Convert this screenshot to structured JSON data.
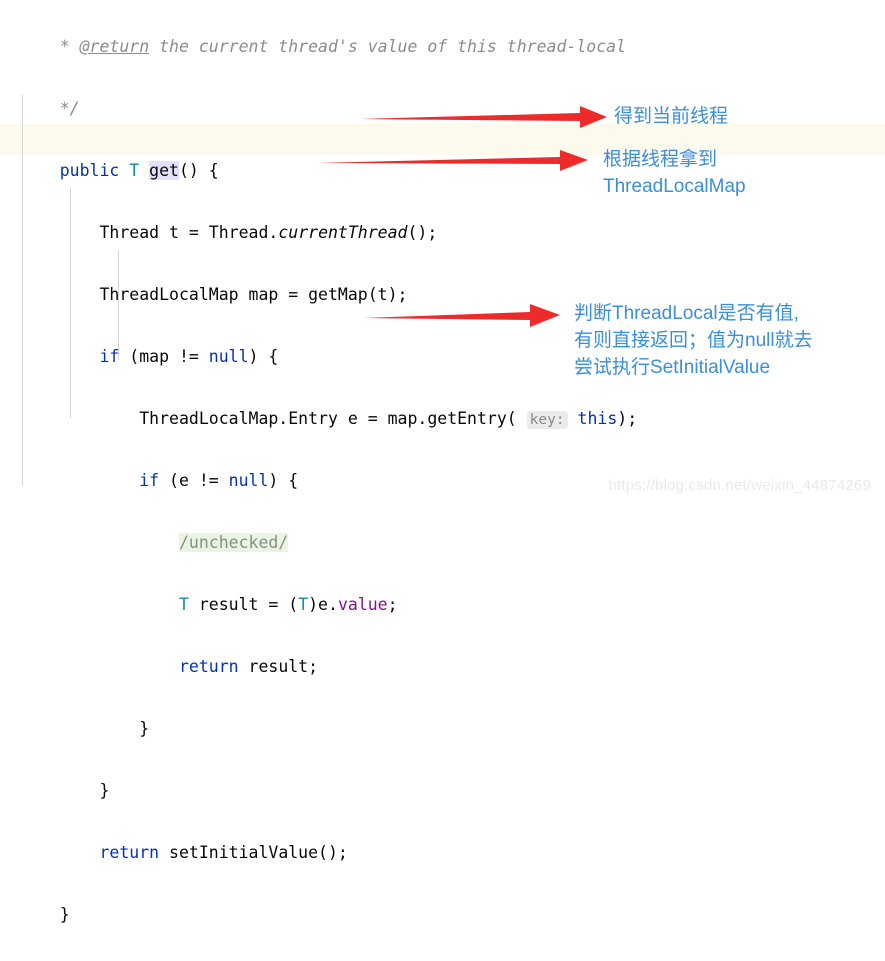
{
  "editor": {
    "theme": "intellij-light",
    "highlighted_line_color": "#fcf9ed",
    "keyword_color": "#0033b3",
    "type_color": "#0b8fa8",
    "field_color": "#871094",
    "comment_color": "#8c8c8c",
    "identifier_highlight_color": "#e4e0fb",
    "unchecked_highlight_color": "#e8f5e1",
    "lines": [
      {
        "id": "javadoc-return",
        "text": "  * @return the current thread's value of this thread-local"
      },
      {
        "id": "javadoc-end",
        "text": "  */"
      },
      {
        "id": "method-signature",
        "text": "public T get() {"
      },
      {
        "id": "thread-current",
        "text": "    Thread t = Thread.currentThread();"
      },
      {
        "id": "get-map",
        "text": "    ThreadLocalMap map = getMap(t);"
      },
      {
        "id": "if-map-not-null",
        "text": "    if (map != null) {"
      },
      {
        "id": "get-entry",
        "text": "        ThreadLocalMap.Entry e = map.getEntry( key: this);"
      },
      {
        "id": "if-e-not-null",
        "text": "        if (e != null) {"
      },
      {
        "id": "unchecked",
        "text": "            /unchecked/"
      },
      {
        "id": "assign-result",
        "text": "            T result = (T)e.value;"
      },
      {
        "id": "return-result",
        "text": "            return result;"
      },
      {
        "id": "close-inner-if",
        "text": "        }"
      },
      {
        "id": "close-outer-if",
        "text": "    }"
      },
      {
        "id": "return-init",
        "text": "    return setInitialValue();"
      },
      {
        "id": "close-method",
        "text": "}"
      }
    ],
    "tokens": {
      "javadoc_star": "*",
      "javadoc_tag": "@return",
      "javadoc_body": " the current thread's value of this thread-local",
      "javadoc_close": "*/",
      "kw_public": "public",
      "generic_T": "T",
      "method_get": "get",
      "paren_open_brace": "() {",
      "cls_Thread": "Thread",
      "var_t": " t = ",
      "cls_Thread2": "Thread",
      "dot": ".",
      "m_currentThread": "currentThread",
      "call_end": "();",
      "cls_ThreadLocalMap": "ThreadLocalMap",
      "var_map": " map = ",
      "m_getMap": "getMap(t);",
      "kw_if": "if",
      "cond_map": " (map != ",
      "kw_null": "null",
      "cond_end": ") {",
      "cls_EntryType": "ThreadLocalMap.Entry",
      "var_e": " e = map.getEntry(",
      "param_hint_key": "key:",
      "kw_this": "this",
      "entry_end": ");",
      "cond_e": " (e != ",
      "unchecked_comment": "/unchecked/",
      "type_T": "T",
      "result_assign": " result = (",
      "type_T2": "T",
      "cast_e": ")e.",
      "field_value": "value",
      "semicolon": ";",
      "kw_return": "return",
      "var_result": " result;",
      "brace_close": "}",
      "m_setInitialValue": " setInitialValue();"
    }
  },
  "annotations": {
    "arrow_color": "#ee2b2b",
    "text_color": "#3a8ede",
    "items": [
      {
        "id": "note-current-thread",
        "text": "得到当前线程",
        "arrow": true
      },
      {
        "id": "note-get-map",
        "text": "根据线程拿到\nThreadLocalMap",
        "arrow": true
      },
      {
        "id": "note-check-value",
        "text": "判断ThreadLocal是否有值,\n有则直接返回；值为null就去\n尝试执行SetInitialValue",
        "arrow": true
      }
    ]
  },
  "watermark": {
    "text": "https://blog.csdn.net/weixin_44874269"
  }
}
